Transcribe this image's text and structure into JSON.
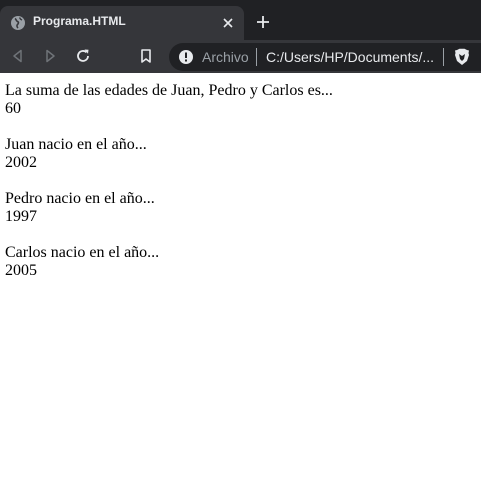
{
  "browser": {
    "tab": {
      "title": "Programa.HTML",
      "icon": "globe-icon"
    },
    "address_bar": {
      "scheme_label": "Archivo",
      "url": "C:/Users/HP/Documents/..."
    }
  },
  "page": {
    "lines": [
      "La suma de las edades de Juan, Pedro y Carlos es...",
      "60",
      "Juan nacio en el año...",
      "2002",
      "Pedro nacio en el año...",
      "1997",
      "Carlos nacio en el año...",
      "2005"
    ]
  },
  "colors": {
    "tab_strip": "#202124",
    "active_tab": "#35363a",
    "omnibox": "#202124",
    "page_background": "#ffffff"
  }
}
